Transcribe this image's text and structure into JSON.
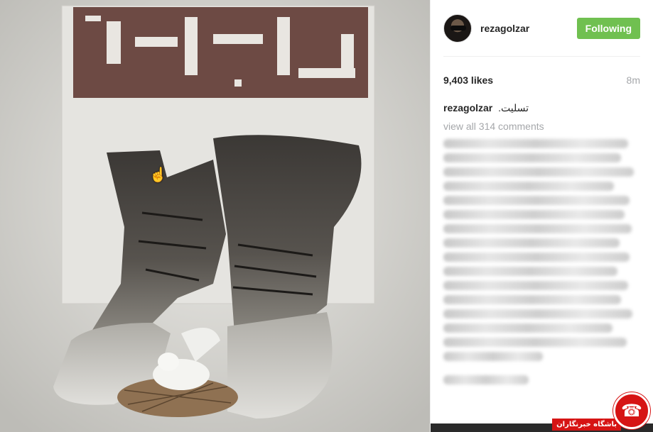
{
  "post": {
    "username": "rezagolzar",
    "follow_label": "Following",
    "likes": "9,403 likes",
    "time": "8m",
    "caption_user": "rezagolzar",
    "caption_text": ".تسلیت",
    "view_all": "view all 314 comments"
  },
  "image": {
    "title_text": "سرباز"
  },
  "watermark": {
    "label": "باشگاه خبرنگاران"
  },
  "colors": {
    "follow_green": "#70c050",
    "title_maroon": "#6d4a44",
    "watermark_red": "#d61414"
  },
  "icons": {
    "cursor": "hand-pointer-icon",
    "logo": "watermark-logo-icon"
  }
}
